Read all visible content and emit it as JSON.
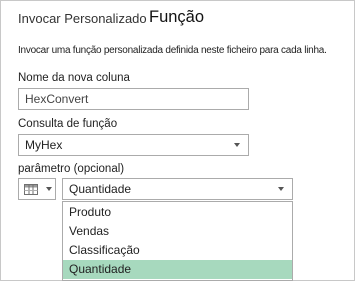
{
  "dialog": {
    "title": "Invocar Personalizado",
    "subtitle": "Função",
    "description": "Invocar uma função personalizada definida neste ficheiro para cada linha."
  },
  "new_column": {
    "label": "Nome da nova coluna",
    "value": "HexConvert"
  },
  "function_query": {
    "label": "Consulta de função",
    "value": "MyHex"
  },
  "parameter": {
    "label": "parâmetro (opcional)",
    "type_icon": "table-column-icon",
    "value": "Quantidade",
    "options": [
      "Produto",
      "Vendas",
      "Classificação",
      "Quantidade"
    ],
    "selected_index": 3
  },
  "colors": {
    "selected_item": "#a7d9be",
    "border": "#ababab"
  }
}
